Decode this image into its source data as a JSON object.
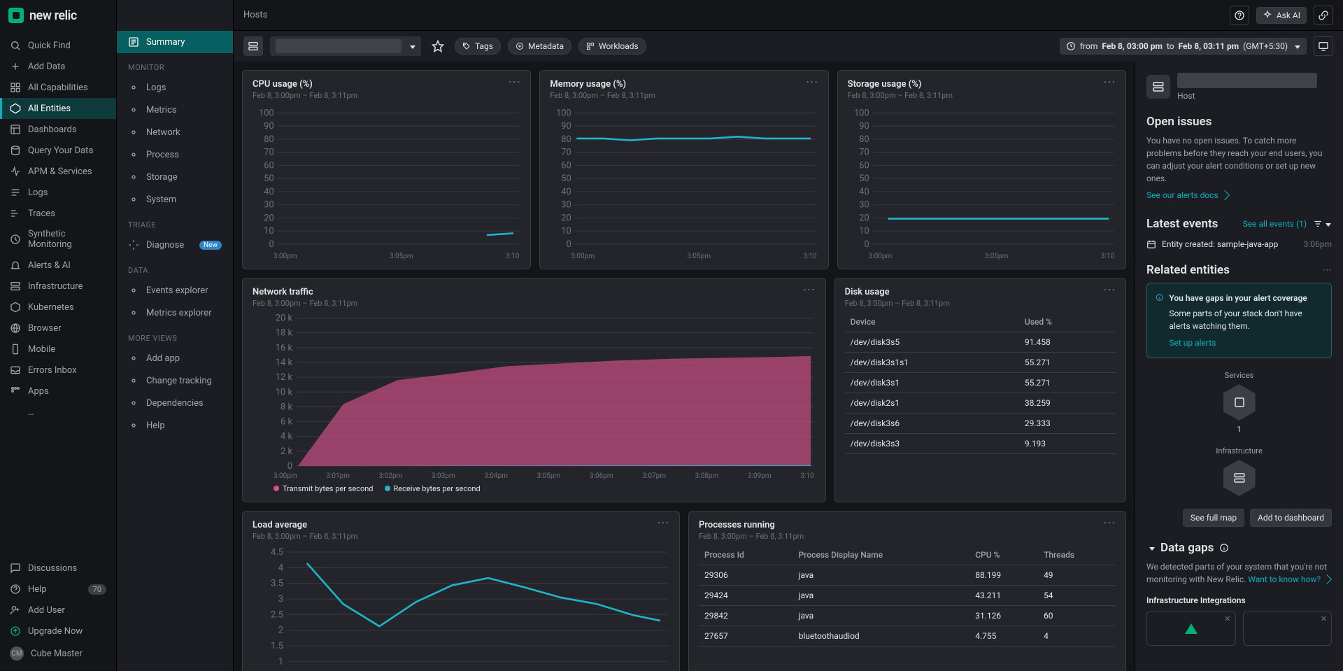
{
  "brand": {
    "wordmark": "new relic"
  },
  "rail": {
    "quick_find": "Quick Find",
    "add_data": "Add Data",
    "all_capabilities": "All Capabilities",
    "all_entities": "All Entities",
    "dashboards": "Dashboards",
    "query": "Query Your Data",
    "apm": "APM & Services",
    "logs": "Logs",
    "traces": "Traces",
    "synthetic": "Synthetic Monitoring",
    "alerts": "Alerts & AI",
    "infra": "Infrastructure",
    "k8s": "Kubernetes",
    "browser": "Browser",
    "mobile": "Mobile",
    "errors": "Errors Inbox",
    "apps": "Apps",
    "more": "…",
    "discussions": "Discussions",
    "help": "Help",
    "help_badge": "70",
    "add_user": "Add User",
    "upgrade": "Upgrade Now",
    "user": "Cube Master"
  },
  "subnav": {
    "summary": "Summary",
    "monitor": "MONITOR",
    "monitor_items": [
      "Logs",
      "Metrics",
      "Network",
      "Process",
      "Storage",
      "System"
    ],
    "triage": "TRIAGE",
    "diagnose": "Diagnose",
    "diagnose_pill": "New",
    "data": "DATA",
    "data_items": [
      "Events explorer",
      "Metrics explorer"
    ],
    "more_views": "MORE VIEWS",
    "more_items": [
      "Add app",
      "Change tracking",
      "Dependencies",
      "Help"
    ]
  },
  "topbar": {
    "breadcrumb": "Hosts",
    "ask_ai": "Ask AI",
    "time_prefix": "from",
    "time_from": "Feb 8, 03:00 pm",
    "time_to_word": "to",
    "time_to": "Feb 8, 03:11 pm",
    "tz": "(GMT+5:30)"
  },
  "subtop": {
    "tags": "Tags",
    "metadata": "Metadata",
    "workloads": "Workloads"
  },
  "cards": {
    "cpu": {
      "title": "CPU usage (%)",
      "sub": "Feb 8, 3:00pm – Feb 8, 3:11pm"
    },
    "mem": {
      "title": "Memory usage (%)",
      "sub": "Feb 8, 3:00pm – Feb 8, 3:11pm"
    },
    "storage": {
      "title": "Storage usage (%)",
      "sub": "Feb 8, 3:00pm – Feb 8, 3:11pm"
    },
    "net": {
      "title": "Network traffic",
      "sub": "Feb 8, 3:00pm – Feb 8, 3:11pm"
    },
    "disk": {
      "title": "Disk usage",
      "sub": "Feb 8, 3:00pm – Feb 8, 3:11pm"
    },
    "load": {
      "title": "Load average",
      "sub": "Feb 8, 3:00pm – Feb 8, 3:11pm"
    },
    "proc": {
      "title": "Processes running",
      "sub": "Feb 8, 3:00pm – Feb 8, 3:11pm"
    }
  },
  "pct_axis": [
    "100",
    "90",
    "80",
    "70",
    "60",
    "50",
    "40",
    "30",
    "20",
    "10",
    "0"
  ],
  "time_axis3": [
    "3:00pm",
    "3:05pm",
    "3:10"
  ],
  "net_yaxis": [
    "20 k",
    "18 k",
    "16 k",
    "14 k",
    "12 k",
    "10 k",
    "8 k",
    "6 k",
    "4 k",
    "2 k",
    "0"
  ],
  "net_xaxis": [
    "3:00pm",
    "3:01pm",
    "3:02pm",
    "3:03pm",
    "3:04pm",
    "3:05pm",
    "3:06pm",
    "3:07pm",
    "3:08pm",
    "3:09pm",
    "3:10"
  ],
  "net_legend": {
    "tx": "Transmit bytes per second",
    "rx": "Receive bytes per second"
  },
  "load_yaxis": [
    "4.5",
    "4",
    "3.5",
    "3",
    "2.5",
    "2",
    "1.5",
    "1"
  ],
  "disk_table": {
    "cols": [
      "Device",
      "Used %"
    ],
    "rows": [
      [
        "/dev/disk3s5",
        "91.458"
      ],
      [
        "/dev/disk3s1s1",
        "55.271"
      ],
      [
        "/dev/disk3s1",
        "55.271"
      ],
      [
        "/dev/disk2s1",
        "38.259"
      ],
      [
        "/dev/disk3s6",
        "29.333"
      ],
      [
        "/dev/disk3s3",
        "9.193"
      ]
    ]
  },
  "proc_table": {
    "cols": [
      "Process Id",
      "Process Display Name",
      "CPU %",
      "Threads"
    ],
    "rows": [
      [
        "29306",
        "java",
        "88.199",
        "49"
      ],
      [
        "29424",
        "java",
        "43.211",
        "54"
      ],
      [
        "29842",
        "java",
        "31.126",
        "60"
      ],
      [
        "27657",
        "bluetoothaudiod",
        "4.755",
        "4"
      ]
    ]
  },
  "side": {
    "host_label": "Host",
    "open_issues": "Open issues",
    "issues_body": "You have no open issues. To catch more problems before they reach your end users, you can adjust your alert conditions or set up new ones.",
    "see_docs": "See our alerts docs",
    "latest_events": "Latest events",
    "see_all": "See all events (1)",
    "event_text": "Entity created: sample-java-app",
    "event_time": "3:06pm",
    "related": "Related entities",
    "gap_title": "You have gaps in your alert coverage",
    "gap_body": "Some parts of your stack don't have alerts watching them.",
    "gap_link": "Set up alerts",
    "services": "Services",
    "services_count": "1",
    "infra": "Infrastructure",
    "see_full_map": "See full map",
    "add_dash": "Add to dashboard",
    "data_gaps": "Data gaps",
    "gaps_body": "We detected parts of your system that you're not monitoring with New Relic.",
    "want_know": "Want to know how?",
    "infra_int": "Infrastructure Integrations"
  },
  "chart_data": [
    {
      "name": "cpu",
      "type": "line",
      "title": "CPU usage (%)",
      "ylim": [
        0,
        100
      ],
      "x": [
        "3:00",
        "3:01",
        "3:02",
        "3:03",
        "3:04",
        "3:05",
        "3:06",
        "3:07",
        "3:08",
        "3:09",
        "3:10"
      ],
      "values": [
        null,
        null,
        null,
        null,
        null,
        null,
        null,
        null,
        null,
        12,
        13
      ]
    },
    {
      "name": "memory",
      "type": "line",
      "title": "Memory usage (%)",
      "ylim": [
        0,
        100
      ],
      "x": [
        "3:00",
        "3:01",
        "3:02",
        "3:03",
        "3:04",
        "3:05",
        "3:06",
        "3:07",
        "3:08",
        "3:09",
        "3:10"
      ],
      "values": [
        80,
        80,
        79,
        80,
        80,
        80,
        81,
        80,
        80,
        80,
        80
      ]
    },
    {
      "name": "storage",
      "type": "line",
      "title": "Storage usage (%)",
      "ylim": [
        0,
        100
      ],
      "x": [
        "3:00",
        "3:01",
        "3:02",
        "3:03",
        "3:04",
        "3:05",
        "3:06",
        "3:07",
        "3:08",
        "3:09",
        "3:10"
      ],
      "values": [
        null,
        22,
        22,
        22,
        22,
        22,
        22,
        22,
        22,
        22,
        22
      ]
    },
    {
      "name": "network",
      "type": "area",
      "title": "Network traffic",
      "ylabel": "bytes/s",
      "ylim": [
        0,
        20000
      ],
      "x": [
        "3:00",
        "3:01",
        "3:02",
        "3:03",
        "3:04",
        "3:05",
        "3:06",
        "3:07",
        "3:08",
        "3:09",
        "3:10"
      ],
      "series": [
        {
          "name": "Transmit bytes per second",
          "values": [
            0,
            8000,
            11000,
            12000,
            13000,
            13500,
            13800,
            14000,
            14100,
            14200,
            14300
          ]
        },
        {
          "name": "Receive bytes per second",
          "values": [
            0,
            100,
            120,
            130,
            130,
            130,
            140,
            140,
            140,
            140,
            140
          ]
        }
      ]
    },
    {
      "name": "load",
      "type": "line",
      "title": "Load average",
      "ylim": [
        1,
        4.5
      ],
      "x": [
        "3:00",
        "3:01",
        "3:02",
        "3:03",
        "3:04",
        "3:05",
        "3:06",
        "3:07",
        "3:08",
        "3:09",
        "3:10"
      ],
      "values": [
        null,
        4.2,
        3.0,
        2.4,
        3.1,
        3.6,
        3.8,
        3.5,
        3.2,
        3.0,
        2.7
      ]
    }
  ]
}
